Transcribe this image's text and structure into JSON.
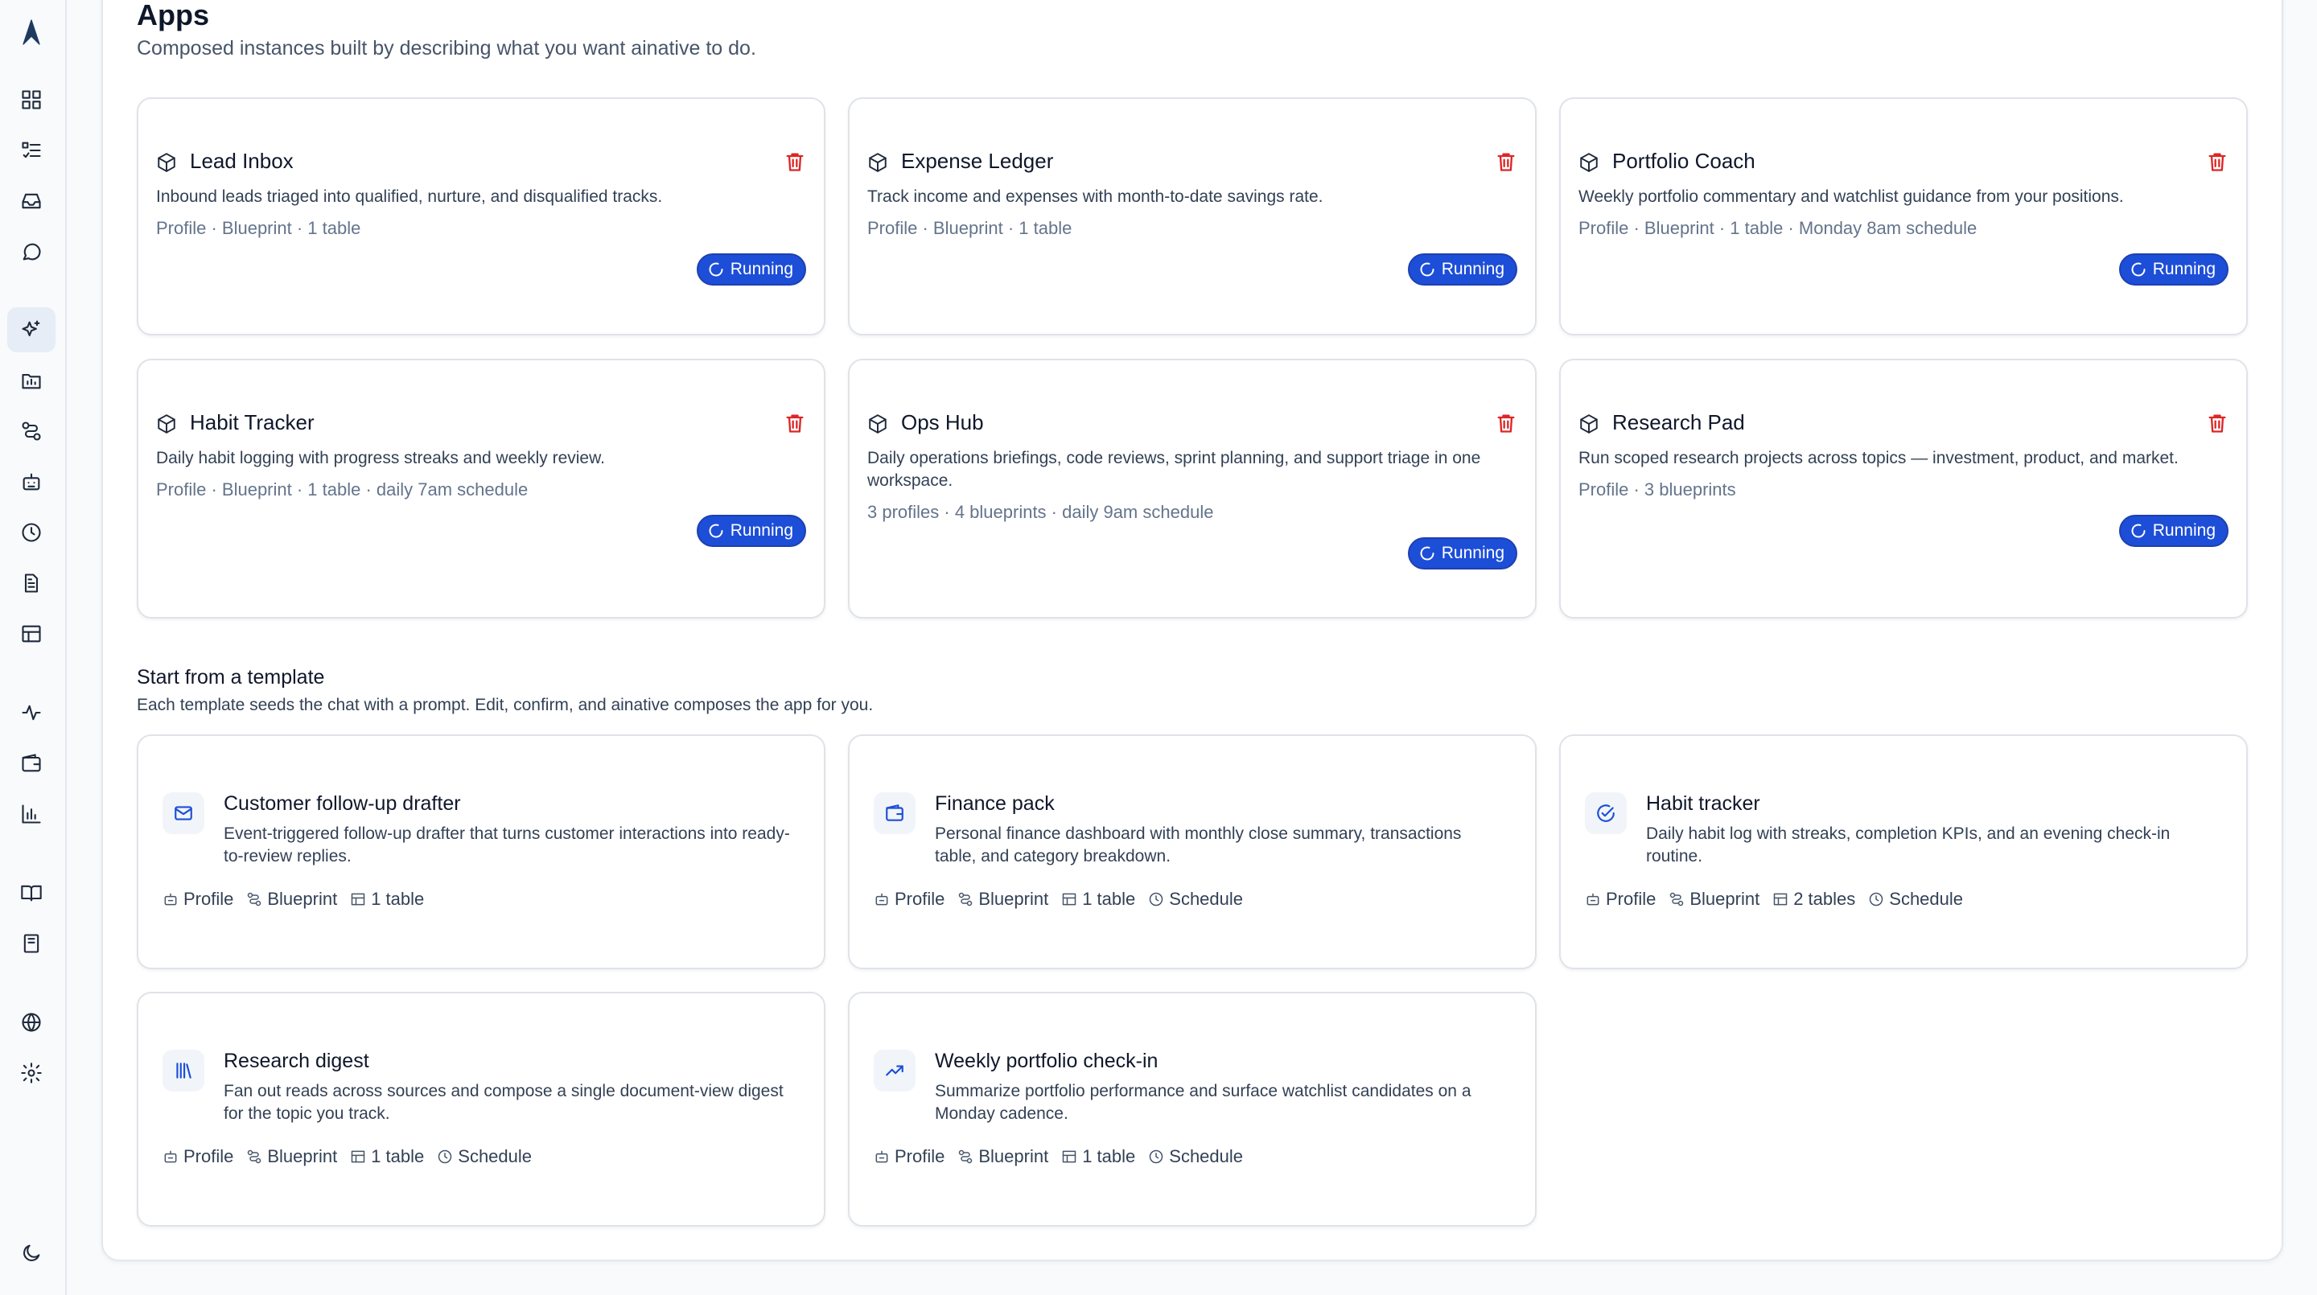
{
  "page": {
    "title": "Apps",
    "subtitle": "Composed instances built by describing what you want ainative to do."
  },
  "sidebar": {
    "icons": [
      "logo-icon",
      "dashboard-icon",
      "tasks-icon",
      "inbox-icon",
      "chat-icon",
      "apps-sparkle-icon",
      "projects-icon",
      "workflows-icon",
      "profiles-icon",
      "schedules-icon",
      "documents-icon",
      "tables-icon",
      "activity-icon",
      "wallet-icon",
      "analytics-icon",
      "book-icon",
      "library-icon",
      "globe-icon",
      "settings-icon",
      "theme-moon-icon"
    ],
    "active": "apps-sparkle-icon"
  },
  "apps": [
    {
      "name": "Lead Inbox",
      "description": "Inbound leads triaged into qualified, nurture, and disqualified tracks.",
      "meta": "Profile · Blueprint · 1 table",
      "status": "Running"
    },
    {
      "name": "Expense Ledger",
      "description": "Track income and expenses with month-to-date savings rate.",
      "meta": "Profile · Blueprint · 1 table",
      "status": "Running"
    },
    {
      "name": "Portfolio Coach",
      "description": "Weekly portfolio commentary and watchlist guidance from your positions.",
      "meta": "Profile · Blueprint · 1 table · Monday 8am schedule",
      "status": "Running"
    },
    {
      "name": "Habit Tracker",
      "description": "Daily habit logging with progress streaks and weekly review.",
      "meta": "Profile · Blueprint · 1 table · daily 7am schedule",
      "status": "Running"
    },
    {
      "name": "Ops Hub",
      "description": "Daily operations briefings, code reviews, sprint planning, and support triage in one workspace.",
      "meta": "3 profiles · 4 blueprints · daily 9am schedule",
      "status": "Running"
    },
    {
      "name": "Research Pad",
      "description": "Run scoped research projects across topics — investment, product, and market.",
      "meta": "Profile · 3 blueprints",
      "status": "Running"
    }
  ],
  "templates_section": {
    "title": "Start from a template",
    "subtitle": "Each template seeds the chat with a prompt. Edit, confirm, and ainative composes the app for you."
  },
  "templates": [
    {
      "name": "Customer follow-up drafter",
      "icon": "mail-icon",
      "description": "Event-triggered follow-up drafter that turns customer interactions into ready-to-review replies.",
      "chips": [
        "Profile",
        "Blueprint",
        "1 table"
      ]
    },
    {
      "name": "Finance pack",
      "icon": "wallet-icon",
      "description": "Personal finance dashboard with monthly close summary, transactions table, and category breakdown.",
      "chips": [
        "Profile",
        "Blueprint",
        "1 table",
        "Schedule"
      ]
    },
    {
      "name": "Habit tracker",
      "icon": "check-circle-icon",
      "description": "Daily habit log with streaks, completion KPIs, and an evening check-in routine.",
      "chips": [
        "Profile",
        "Blueprint",
        "2 tables",
        "Schedule"
      ]
    },
    {
      "name": "Research digest",
      "icon": "library-icon",
      "description": "Fan out reads across sources and compose a single document-view digest for the topic you track.",
      "chips": [
        "Profile",
        "Blueprint",
        "1 table",
        "Schedule"
      ]
    },
    {
      "name": "Weekly portfolio check-in",
      "icon": "trending-up-icon",
      "description": "Summarize portfolio performance and surface watchlist candidates on a Monday cadence.",
      "chips": [
        "Profile",
        "Blueprint",
        "1 table",
        "Schedule"
      ]
    }
  ],
  "colors": {
    "accent": "#1d4ed8",
    "danger": "#dc2626",
    "muted": "#64748b"
  }
}
